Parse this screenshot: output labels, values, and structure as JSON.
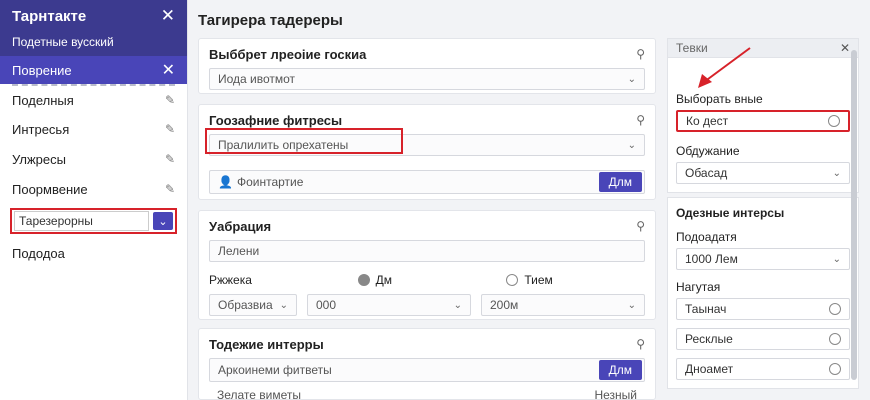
{
  "sidebar": {
    "title": "Тарнтакте",
    "subtitle": "Подетные вусский",
    "active_item": "Поврение",
    "items": [
      {
        "label": "Поделныя"
      },
      {
        "label": "Интресья"
      },
      {
        "label": "Улжресы"
      },
      {
        "label": "Поормвение"
      }
    ],
    "input_value": "Тарезерорны",
    "last_item": "Пододоа"
  },
  "main": {
    "title": "Тагирера тадереры",
    "card1": {
      "label": "Выббрет лреоіие госкиа",
      "value": "Иода ивотмот"
    },
    "card2": {
      "label": "Гоозафние фитресы",
      "value": "Пралилить опрехатены",
      "input_placeholder": "Фоинтартие",
      "button": "Длм"
    },
    "card3": {
      "label": "Уабрация",
      "value": "Лелени",
      "sub_label": "Ржжека",
      "radio1": "Дм",
      "radio2": "Тием",
      "sel1": "Образвиа",
      "sel2": "000",
      "sel3": "200м"
    },
    "card4": {
      "label": "Тодежие интерры",
      "input_placeholder": "Аркоинеми фитветы",
      "button": "Длм",
      "footer_text": "Зелате виметы",
      "footer_right": "Незный"
    }
  },
  "right_panel": {
    "header": "Тевки",
    "label1": "Выборать вные",
    "field1": "Ко дест",
    "label2": "Обдужание",
    "field2": "Обасад",
    "section": "Одезные интерсы",
    "label3": "Подоадатя",
    "field3": "1000 Лем",
    "label4": "Нагутая",
    "field4": "Таынач",
    "field5": "Ресклые",
    "field6": "Дноамет"
  },
  "colors": {
    "accent": "#4945b8",
    "header": "#3c3a8f",
    "highlight": "#d7222a"
  }
}
